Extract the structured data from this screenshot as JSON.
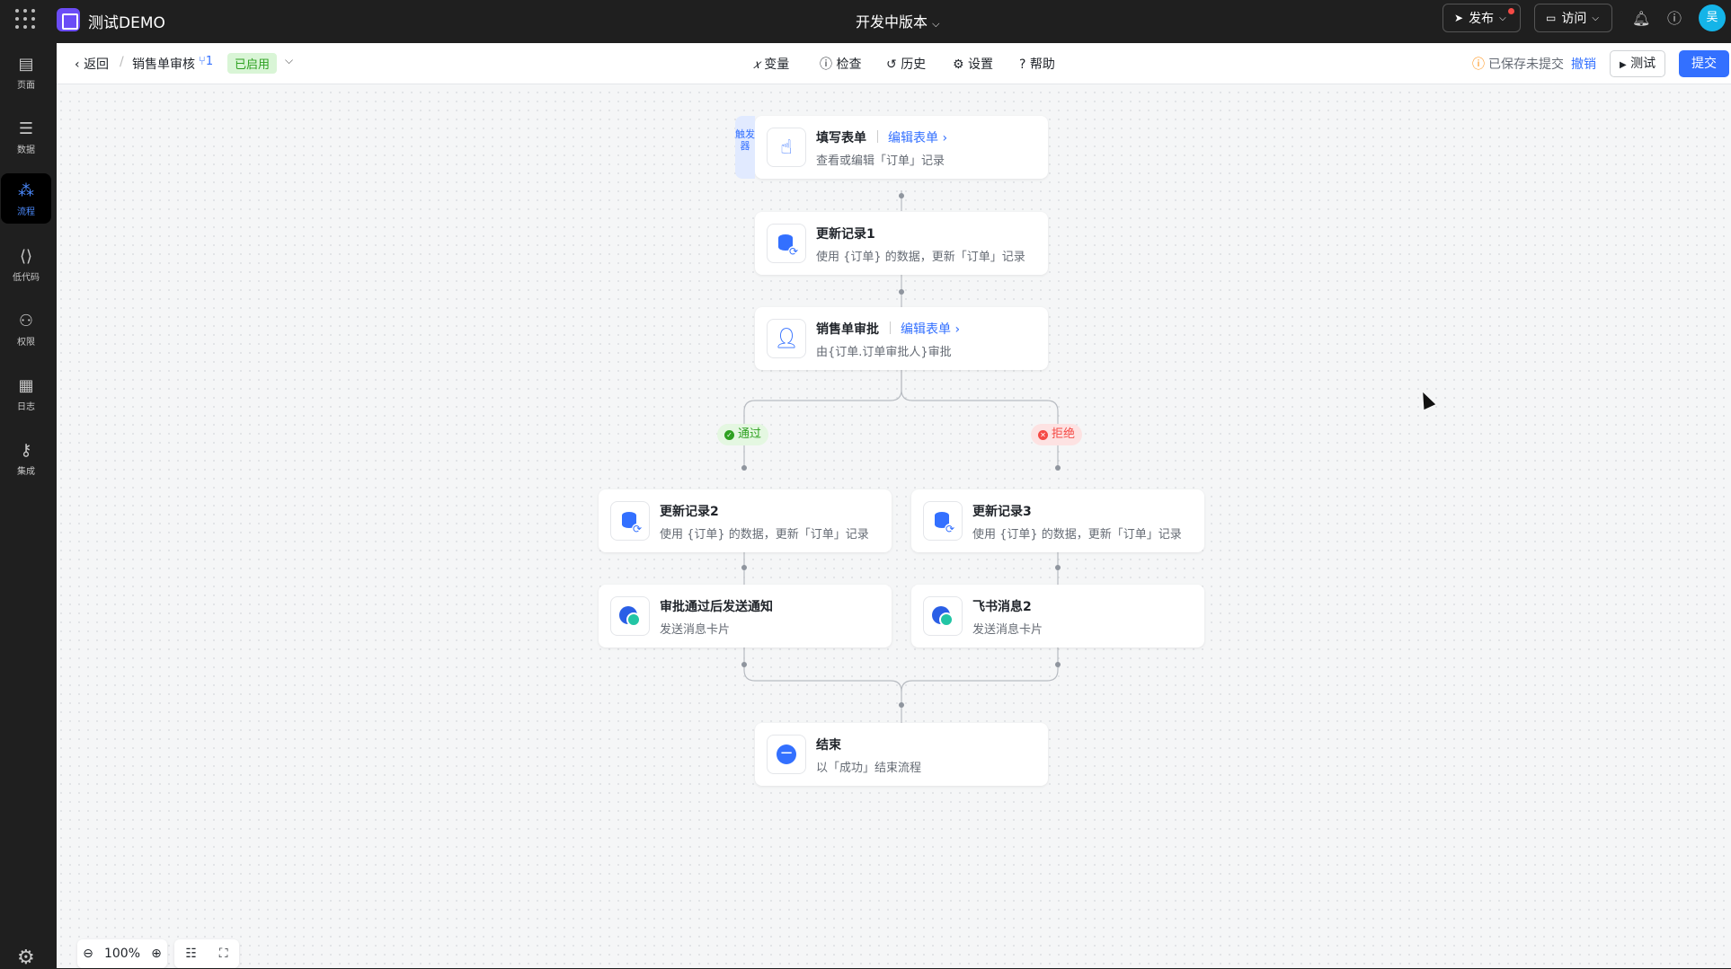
{
  "topbar": {
    "app_title": "测试DEMO",
    "version_label": "开发中版本",
    "publish_label": "发布",
    "visit_label": "访问",
    "avatar_text": "吴"
  },
  "sidebar": {
    "items": [
      {
        "label": "页面",
        "icon": "page-icon"
      },
      {
        "label": "数据",
        "icon": "database-icon"
      },
      {
        "label": "流程",
        "icon": "flow-icon",
        "active": true
      },
      {
        "label": "低代码",
        "icon": "code-icon"
      },
      {
        "label": "权限",
        "icon": "users-icon"
      },
      {
        "label": "日志",
        "icon": "log-icon"
      },
      {
        "label": "集成",
        "icon": "key-icon"
      }
    ]
  },
  "toolbar": {
    "back_label": "返回",
    "flow_name": "销售单审核",
    "flow_version": "1",
    "status_badge": "已启用",
    "tools": [
      "变量",
      "检查",
      "历史",
      "设置",
      "帮助"
    ],
    "saved_status": "已保存未提交",
    "undo_label": "撤销",
    "test_label": "测试",
    "submit_label": "提交"
  },
  "flow": {
    "trigger_tag": "触发器",
    "nodes": {
      "fill_form": {
        "title": "填写表单",
        "link": "编辑表单",
        "subtitle": "查看或编辑「订单」记录"
      },
      "update1": {
        "title": "更新记录1",
        "subtitle": "使用 {订单} 的数据，更新「订单」记录"
      },
      "approval": {
        "title": "销售单审批",
        "link": "编辑表单",
        "subtitle": "由{订单.订单审批人}审批"
      },
      "update2": {
        "title": "更新记录2",
        "subtitle": "使用 {订单} 的数据，更新「订单」记录"
      },
      "update3": {
        "title": "更新记录3",
        "subtitle": "使用 {订单} 的数据，更新「订单」记录"
      },
      "notify_pass": {
        "title": "审批通过后发送通知",
        "subtitle": "发送消息卡片"
      },
      "feishu2": {
        "title": "飞书消息2",
        "subtitle": "发送消息卡片"
      },
      "end": {
        "title": "结束",
        "subtitle": "以「成功」结束流程"
      }
    },
    "branches": {
      "pass": "通过",
      "reject": "拒绝"
    }
  },
  "zoom": {
    "level": "100%"
  },
  "colors": {
    "accent": "#3370ff",
    "success": "#2ea121",
    "danger": "#f54a45",
    "topbar": "#1f1f1f"
  }
}
